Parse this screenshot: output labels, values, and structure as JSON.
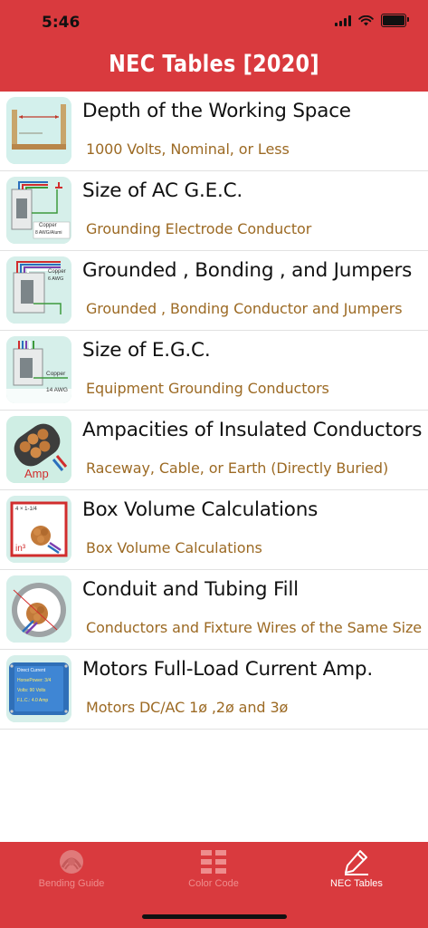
{
  "status_bar": {
    "time": "5:46"
  },
  "header": {
    "title": "NEC Tables [2020]"
  },
  "items": [
    {
      "title": "Depth of the Working Space",
      "subtitle": "1000 Volts, Nominal, or Less",
      "icon": "working-space-diagram-icon"
    },
    {
      "title": "Size of AC G.E.C.",
      "subtitle": "Grounding Electrode Conductor",
      "icon": "gec-diagram-icon"
    },
    {
      "title": "Grounded , Bonding , and Jumpers",
      "subtitle": "Grounded , Bonding Conductor and Jumpers",
      "icon": "bonding-diagram-icon"
    },
    {
      "title": "Size of E.G.C.",
      "subtitle": "Equipment Grounding Conductors",
      "icon": "egc-diagram-icon"
    },
    {
      "title": "Ampacities of Insulated Conductors",
      "subtitle": "Raceway, Cable, or Earth (Directly Buried)",
      "icon": "conductor-bundle-amp-icon"
    },
    {
      "title": "Box Volume Calculations",
      "subtitle": "Box Volume Calculations",
      "icon": "box-volume-icon"
    },
    {
      "title": "Conduit and Tubing Fill",
      "subtitle": "Conductors and Fixture Wires of the Same Size",
      "icon": "conduit-fill-icon"
    },
    {
      "title": "Motors Full-Load Current Amp.",
      "subtitle": "Motors DC/AC 1ø ,2ø and 3ø",
      "icon": "motor-nameplate-icon"
    }
  ],
  "thumb_text": {
    "gec_copper": "Copper",
    "gec_awg": "8 AWG/Alumi",
    "bond_copper": "Copper",
    "bond_awg": "6 AWG",
    "egc_copper": "Copper",
    "egc_awg": "14 AWG",
    "amp": "Amp",
    "box_dim": "4 × 1-1/4",
    "box_unit": "in³",
    "motor_l1": "Direct Current",
    "motor_l2": "HorsePower: 3/4",
    "motor_l3": "Volts: 90 Volts",
    "motor_l4": "F.L.C.: 4.0 Amp"
  },
  "tabbar": {
    "tabs": [
      {
        "label": "Bending Guide",
        "icon": "conduit-bend-icon",
        "active": false
      },
      {
        "label": "Color Code",
        "icon": "color-code-grid-icon",
        "active": false
      },
      {
        "label": "NEC Tables",
        "icon": "pencil-icon",
        "active": true
      }
    ]
  },
  "colors": {
    "brand_red": "#d93a3e",
    "subtitle_brown": "#9c6a24",
    "inactive_tab": "#ee8d8d",
    "active_tab": "#ffffff"
  }
}
